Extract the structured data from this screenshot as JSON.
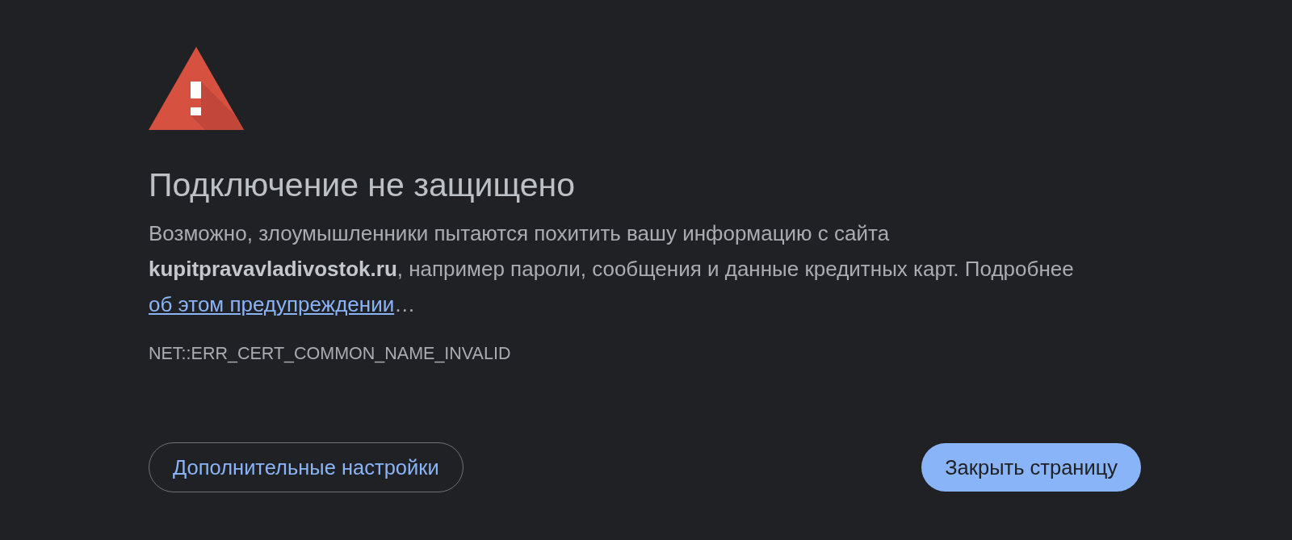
{
  "heading": "Подключение не защищено",
  "message": {
    "text": "Возможно, злоумышленники пытаются похитить вашу информацию с сайта **kupitpravavladivostok.ru**, например пароли, сообщения и данные кредитных карт. Подробнее",
    "link": "об этом предупреждении",
    "after": "…"
  },
  "error_code": "NET::ERR_CERT_COMMON_NAME_INVALID",
  "buttons": [
    {
      "label": "Дополнительные настройки",
      "kind": "secondary"
    },
    {
      "label": "Закрыть страницу",
      "kind": "primary"
    }
  ]
}
